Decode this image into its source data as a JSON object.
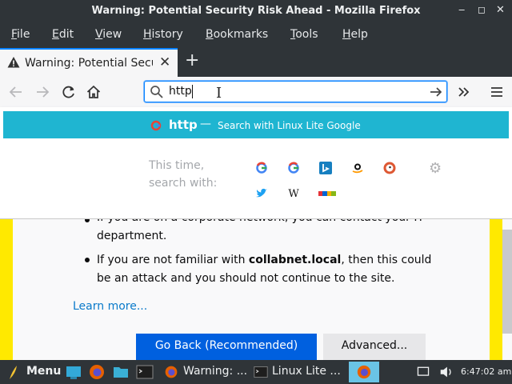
{
  "window": {
    "title": "Warning: Potential Security Risk Ahead - Mozilla Firefox",
    "controls": {
      "minimize": "‒",
      "maximize": "◻",
      "close": "✕"
    }
  },
  "menu": [
    "File",
    "Edit",
    "View",
    "History",
    "Bookmarks",
    "Tools",
    "Help"
  ],
  "tab": {
    "label": "Warning: Potential Security Risk Ahead",
    "close": "✕",
    "new_tab": "+"
  },
  "urlbar": {
    "value": "http"
  },
  "suggestion": {
    "query": "http",
    "separator": "—",
    "action": "Search with Linux Lite Google"
  },
  "one_off": {
    "label_line1": "This time,",
    "label_line2": "search with:",
    "engines": [
      "google",
      "google",
      "bing",
      "amazon",
      "duckduckgo",
      "twitter",
      "wikipedia",
      "ebay"
    ]
  },
  "page": {
    "item1_line1": "If you are on a corporate network, you can contact your IT",
    "item1_line2": "department.",
    "item2_pre": "If you are not familiar with ",
    "item2_bold": "collabnet.local",
    "item2_post": ", then this could",
    "item2_line2": "be an attack and you should not continue to the site.",
    "learn_more": "Learn more...",
    "go_back": "Go Back (Recommended)",
    "advanced": "Advanced..."
  },
  "taskbar": {
    "menu": "Menu",
    "task1": "Warning: ...",
    "task2": "Linux Lite ...",
    "clock": "6:47:02 am"
  },
  "colors": {
    "accent": "#0a84ff",
    "suggestion_bg": "#1fb5d1",
    "primary_button": "#0060df",
    "warning_stripe": "#ffe900"
  }
}
